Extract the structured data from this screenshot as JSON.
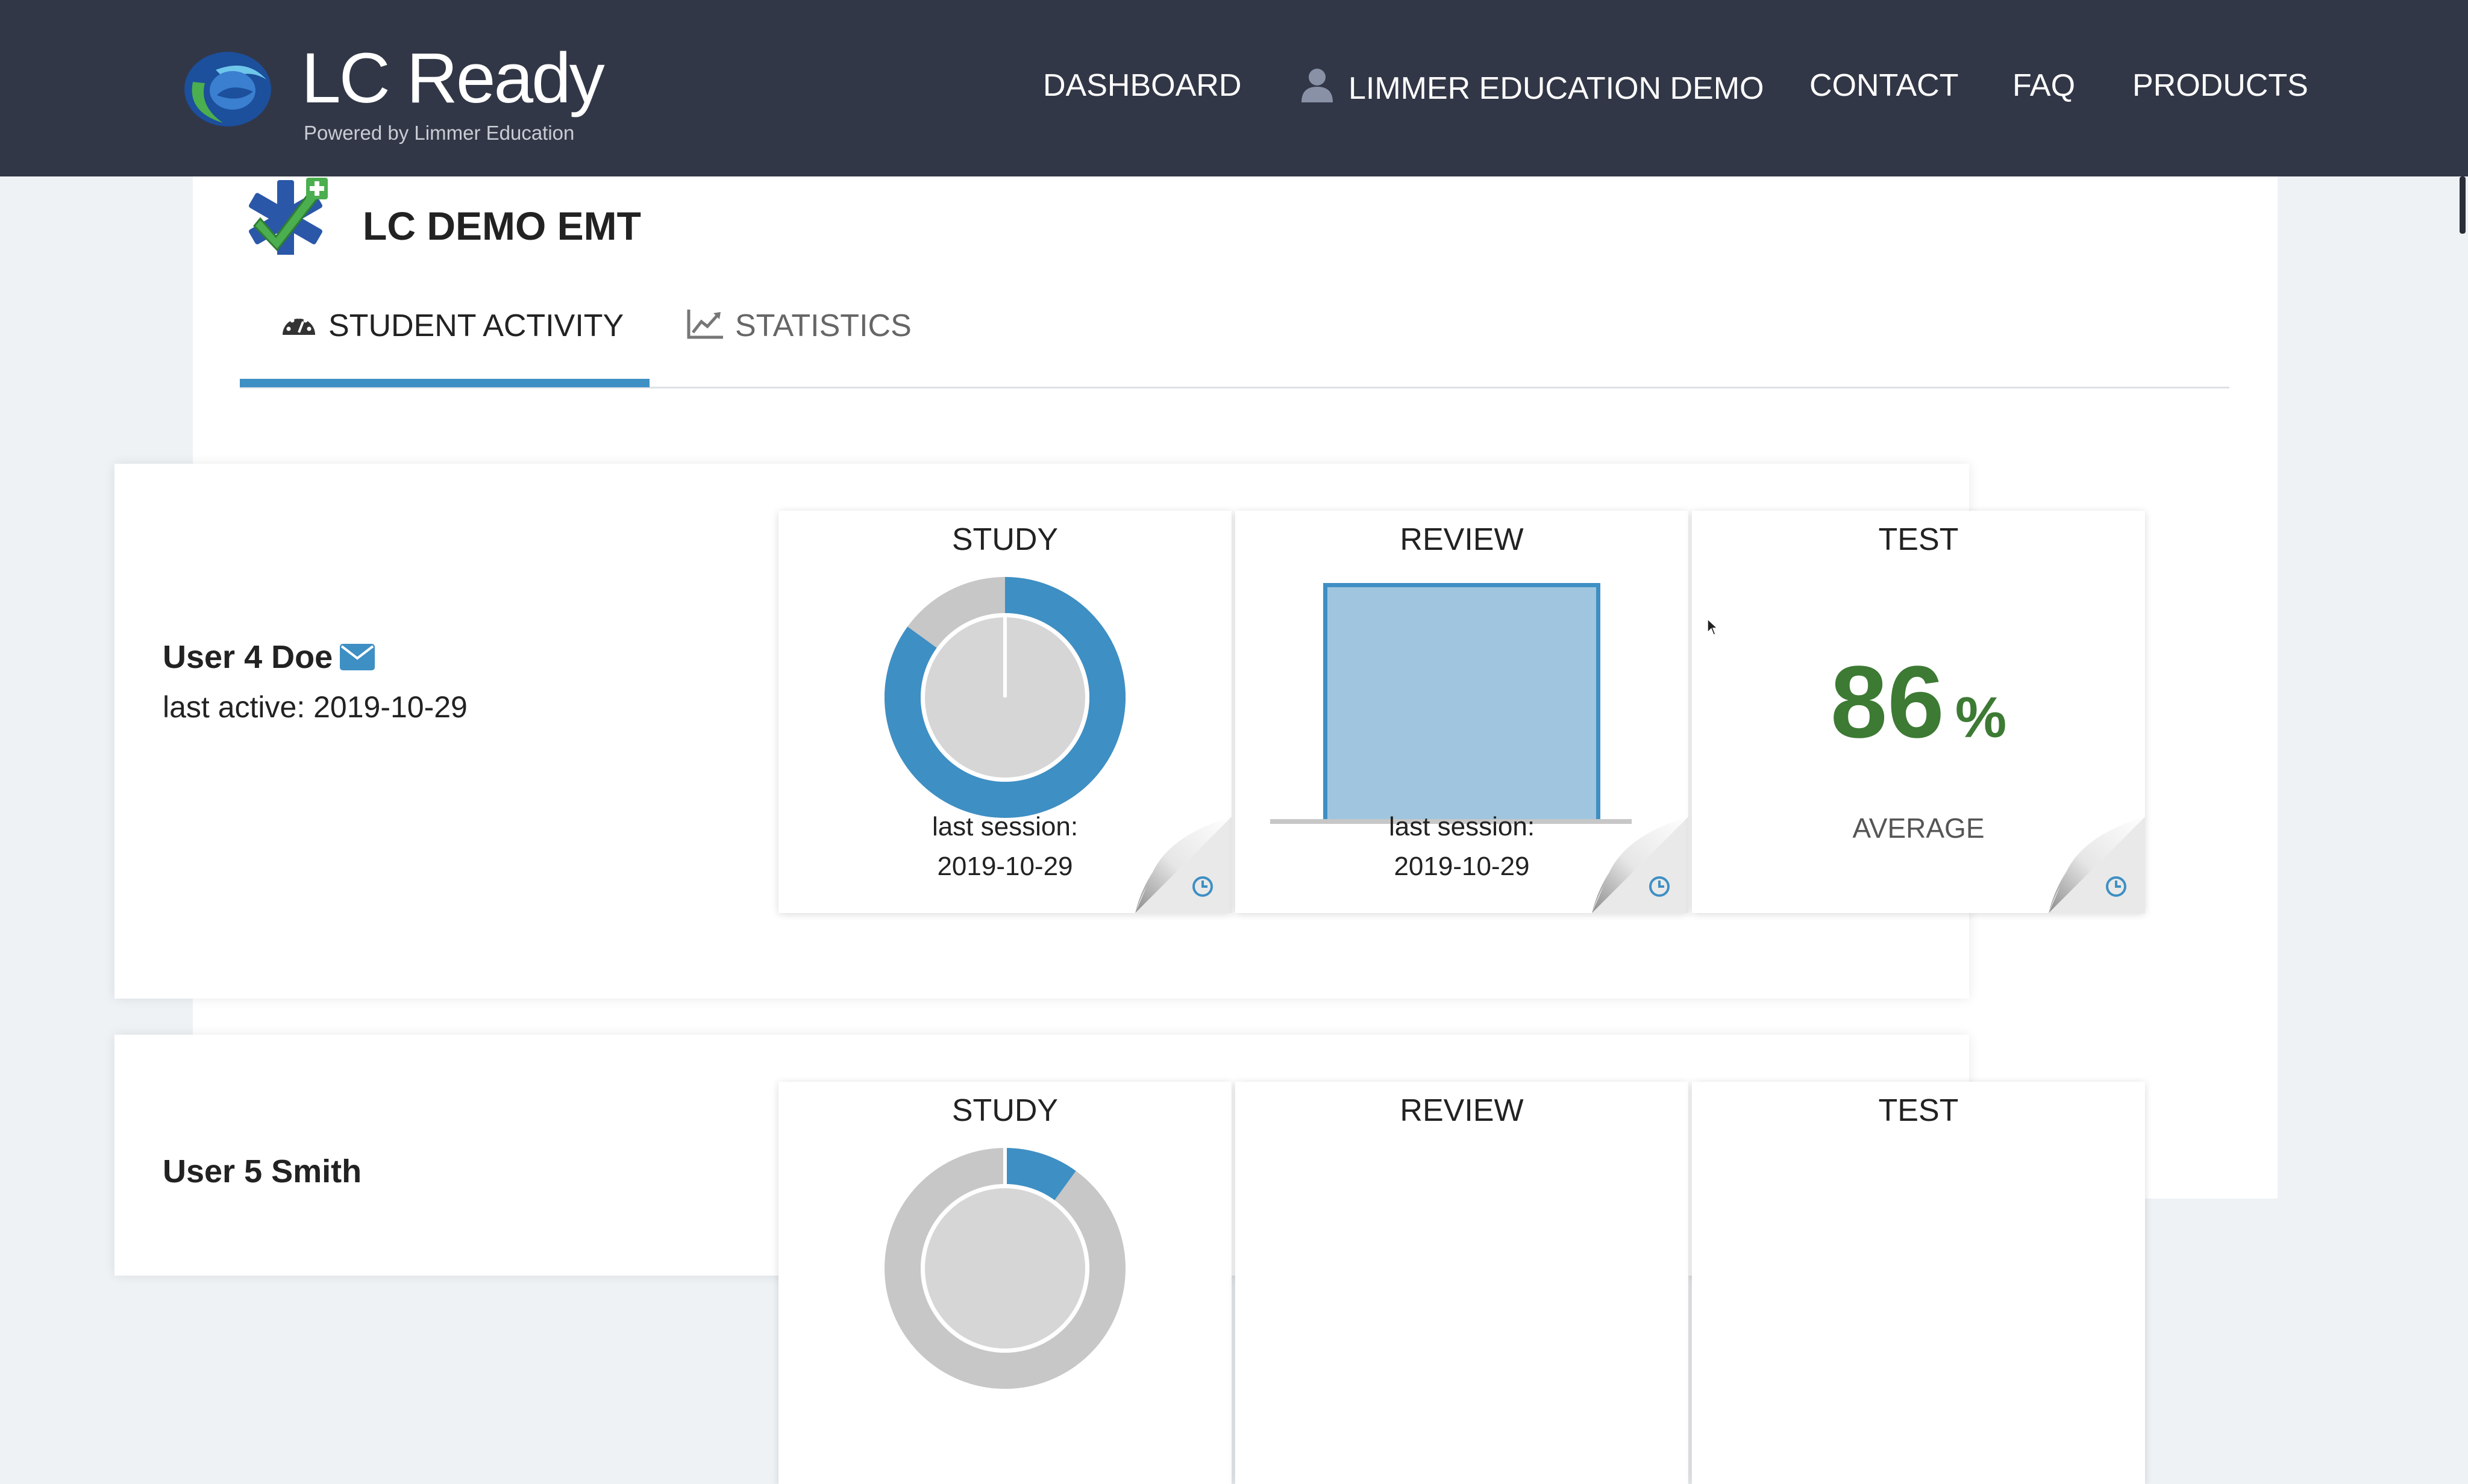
{
  "nav": {
    "brand": "LC Ready",
    "tagline": "Powered by Limmer Education",
    "items": {
      "dashboard": "DASHBOARD",
      "account": "LIMMER EDUCATION DEMO",
      "contact": "CONTACT",
      "faq": "FAQ",
      "products": "PRODUCTS"
    }
  },
  "page": {
    "title": "LC DEMO EMT",
    "tabs": {
      "activity": "STUDENT ACTIVITY",
      "statistics": "STATISTICS"
    }
  },
  "students": [
    {
      "name": "User 4 Doe",
      "last_active": "last active: 2019-10-29",
      "study": {
        "title": "STUDY",
        "progress": 0.85,
        "caption": "last session:",
        "date": "2019-10-29"
      },
      "review": {
        "title": "REVIEW",
        "fill": 1.0,
        "caption": "last session:",
        "date": "2019-10-29"
      },
      "test": {
        "title": "TEST",
        "average": "86",
        "unit": "%",
        "label": "AVERAGE"
      }
    },
    {
      "name": "User 5 Smith",
      "study": {
        "title": "STUDY",
        "progress": 0.1
      },
      "review": {
        "title": "REVIEW"
      },
      "test": {
        "title": "TEST"
      }
    }
  ],
  "colors": {
    "navbar": "#323747",
    "accent": "#3e8fc4",
    "donut": "#3e8fc4",
    "donut_remaining": "#c7c7c7",
    "review_fill": "#9fc6de",
    "score": "#3d7a34"
  }
}
